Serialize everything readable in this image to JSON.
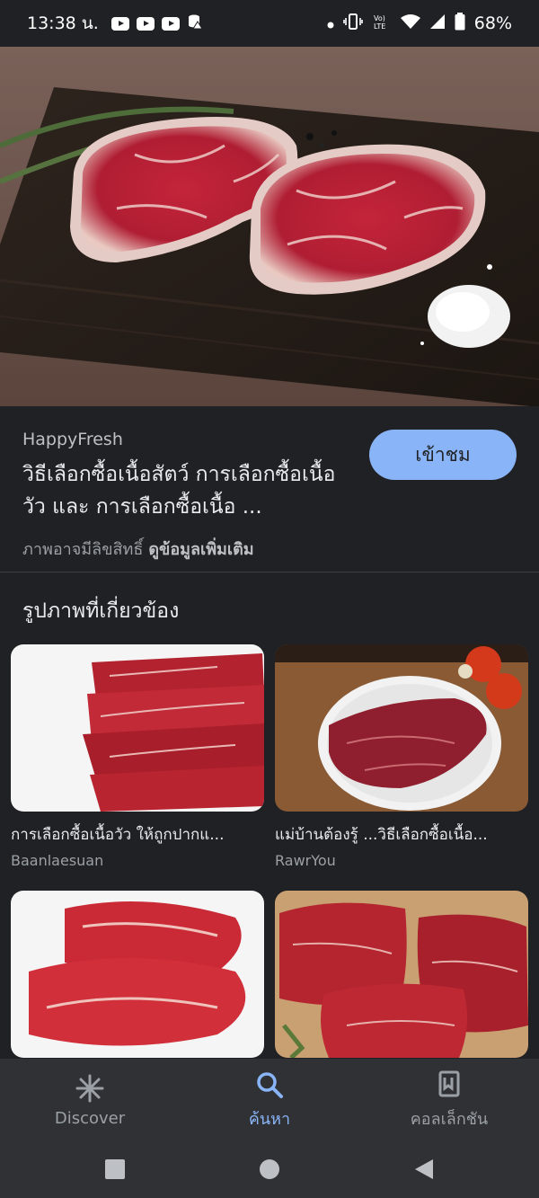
{
  "status_bar": {
    "time": "13:38 น.",
    "battery": "68%"
  },
  "source": {
    "name": "HappyFresh",
    "title": "วิธีเลือกซื้อเนื้อสัตว์ การเลือกซื้อเนื้อวัว และ การเลือกซื้อเนื้อ ...",
    "visit_label": "เข้าชม",
    "copyright": "ภาพอาจมีลิขสิทธิ์",
    "more_info": "ดูข้อมูลเพิ่มเติม"
  },
  "related": {
    "heading": "รูปภาพที่เกี่ยวข้อง",
    "items": [
      {
        "title": "การเลือกซื้อเนื้อวัว ให้ถูกปากแ...",
        "source": "Baanlaesuan"
      },
      {
        "title": "แม่บ้านต้องรู้ ...วิธีเลือกซื้อเนื้อ...",
        "source": "RawrYou"
      },
      {
        "title": "",
        "source": ""
      },
      {
        "title": "",
        "source": ""
      }
    ]
  },
  "bottom_nav": {
    "items": [
      {
        "label": "Discover",
        "icon": "asterisk-icon"
      },
      {
        "label": "ค้นหา",
        "icon": "search-icon"
      },
      {
        "label": "คอลเล็กชัน",
        "icon": "collections-icon"
      }
    ]
  },
  "colors": {
    "background": "#202124",
    "accent": "#8ab4f8"
  }
}
